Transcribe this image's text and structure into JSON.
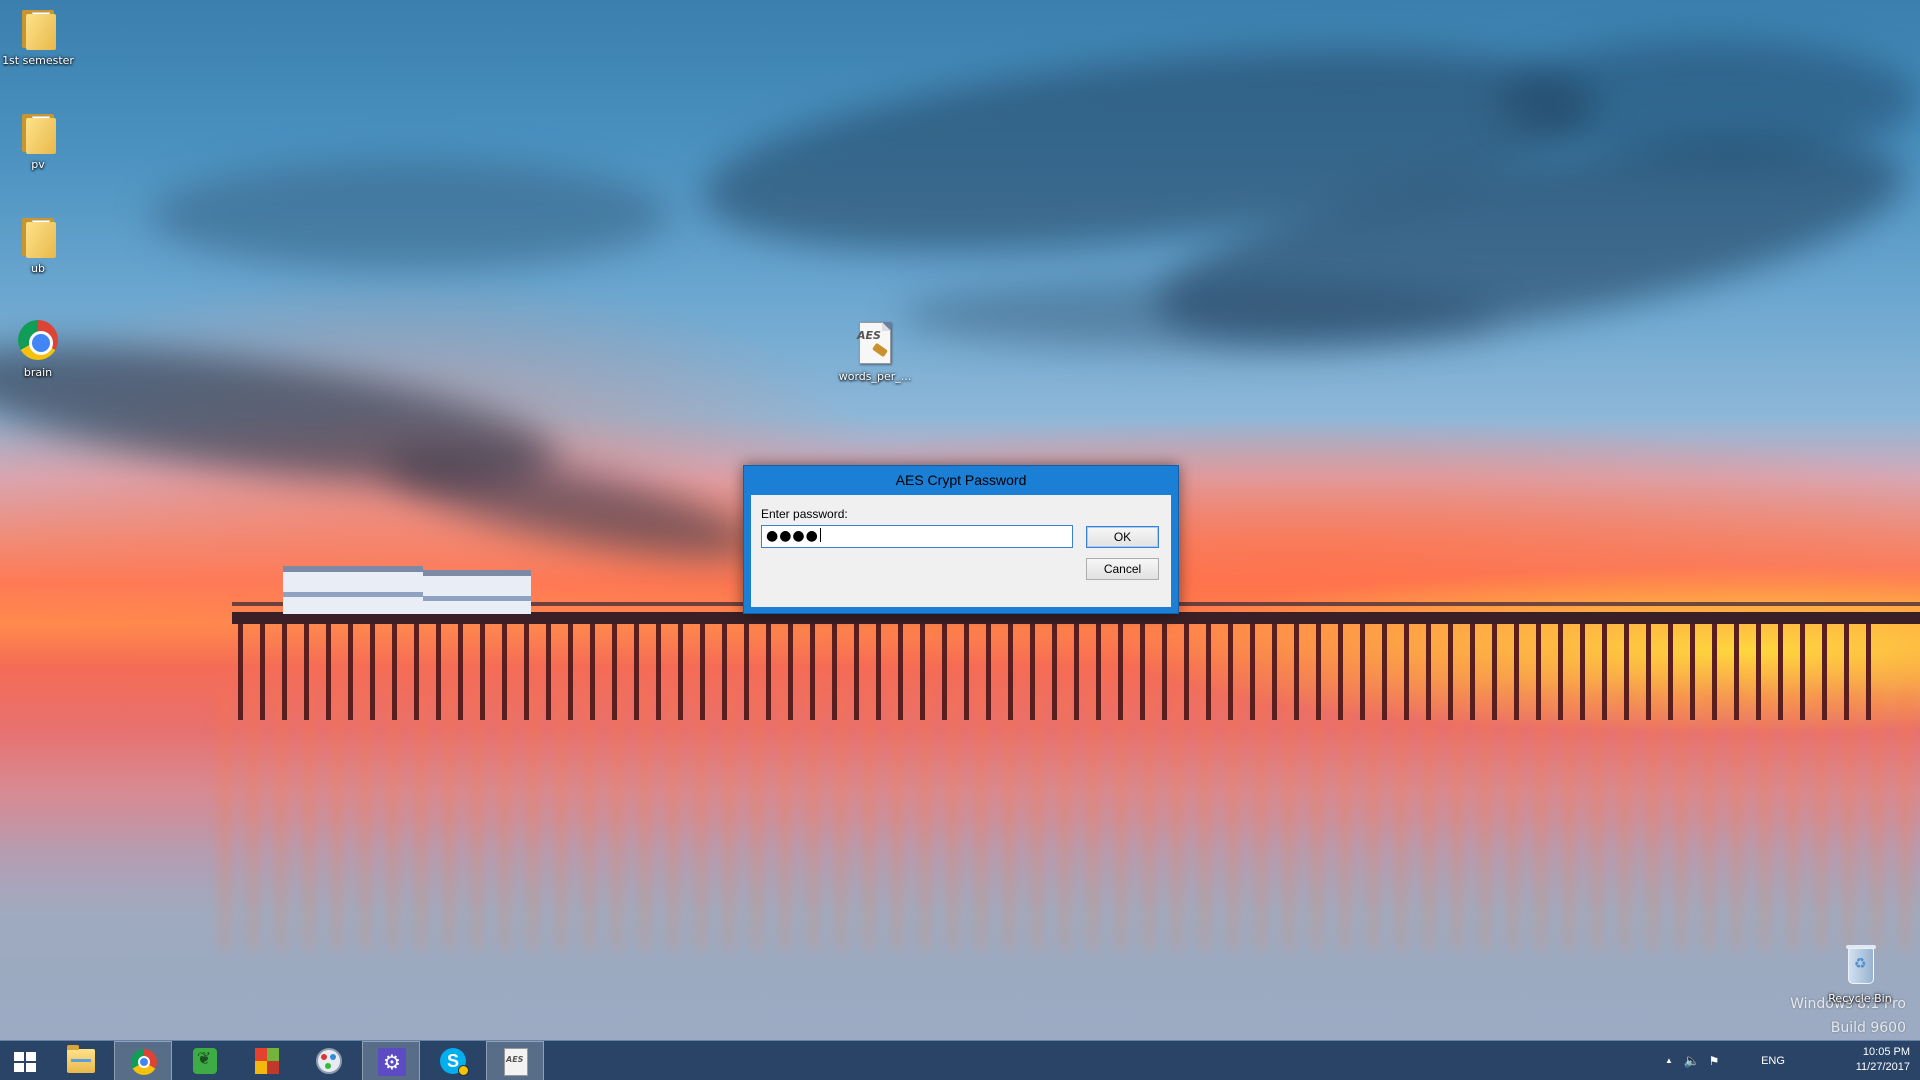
{
  "desktop": {
    "icons": [
      {
        "label": "1st semester",
        "icon": "folder-icon"
      },
      {
        "label": "pv",
        "icon": "folder-icon"
      },
      {
        "label": "ub",
        "icon": "folder-icon"
      },
      {
        "label": "brain",
        "icon": "chrome-icon"
      },
      {
        "label": "words_per_...",
        "icon": "aes-file-icon"
      },
      {
        "label": "Recycle Bin",
        "icon": "recycle-bin-icon"
      }
    ],
    "watermark": {
      "line1": "Windows 8.1 Pro",
      "line2": "Build 9600"
    }
  },
  "dialog": {
    "title": "AES Crypt Password",
    "label": "Enter password:",
    "password_value": "●●●●",
    "ok_label": "OK",
    "cancel_label": "Cancel"
  },
  "taskbar": {
    "apps": [
      {
        "name": "start",
        "icon": "windows-start-icon"
      },
      {
        "name": "file-explorer",
        "icon": "file-explorer-icon"
      },
      {
        "name": "chrome",
        "icon": "chrome-icon",
        "active": true
      },
      {
        "name": "evernote",
        "icon": "evernote-icon"
      },
      {
        "name": "office",
        "icon": "office-icon"
      },
      {
        "name": "paint",
        "icon": "paint-icon"
      },
      {
        "name": "settings",
        "icon": "settings-icon",
        "active": true
      },
      {
        "name": "skype",
        "icon": "skype-icon"
      },
      {
        "name": "aes-crypt",
        "icon": "aes-crypt-icon",
        "active": true
      }
    ],
    "tray": {
      "chevron": "▲",
      "language": "ENG",
      "time": "10:05 PM",
      "date": "11/27/2017"
    }
  },
  "colors": {
    "dialog_frame": "#1b7fd6",
    "taskbar": "#264062",
    "input_focus": "#3c7fd6"
  }
}
